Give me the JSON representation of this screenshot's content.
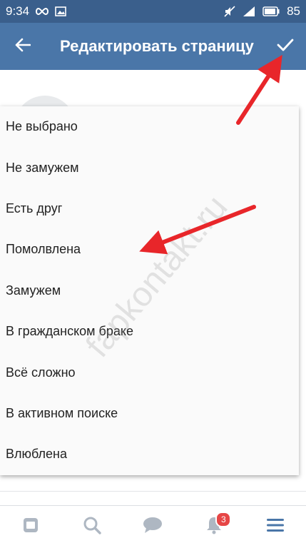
{
  "status_bar": {
    "time": "9:34",
    "battery": "85",
    "icons": [
      "infinity-icon",
      "image-icon",
      "mute-icon",
      "network-icon",
      "battery-icon"
    ]
  },
  "app_bar": {
    "title": "Редактировать страницу",
    "back_icon": "arrow-left-icon",
    "confirm_icon": "check-icon"
  },
  "dropdown": {
    "options": [
      "Не выбрано",
      "Не замужем",
      "Есть друг",
      "Помолвлена",
      "Замужем",
      "В гражданском браке",
      "Всё сложно",
      "В активном поиске",
      "Влюблена"
    ]
  },
  "watermark": "fapkontakt.ru",
  "bottom_nav": {
    "items": [
      "news-icon",
      "search-icon",
      "messages-icon",
      "notifications-icon",
      "menu-icon"
    ],
    "notifications_badge": "3"
  },
  "colors": {
    "status_bar": "#3a5f8c",
    "app_bar": "#4a76a8",
    "arrow": "#e8262a",
    "nav_icon": "#aeb7c2",
    "nav_active": "#4a76a8",
    "badge": "#e64646"
  }
}
